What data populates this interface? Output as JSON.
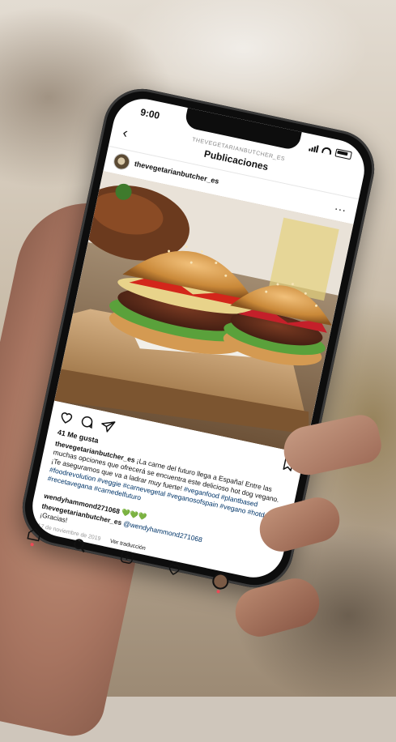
{
  "status": {
    "time": "9:00"
  },
  "header": {
    "account_handle": "THEVEGETARIANBUTCHER_ES",
    "title": "Publicaciones"
  },
  "post": {
    "username": "thevegetarianbutcher_es",
    "more_label": "...",
    "likes": "41 Me gusta",
    "caption_user": "thevegetarianbutcher_es",
    "caption_text": " ¡La carne del futuro llega a España! Entre las muchas opciones que ofrecerá se encuentra este delicioso hot dog vegano. ¡Te aseguramos que va a ladrar muy fuerte!",
    "hashtags": "#veganfood #plantbased #foodrevolution #veggie #carnevegetal #veganosofspain #vegano #hotdog #recetavegana #carnedelfuturo",
    "comment_user": "wendyhammond271068",
    "comment_text": " 💚💚💚",
    "reply_user": "thevegetarianbutcher_es",
    "reply_mention": "@wendyhammond271068",
    "reply_text": "¡Gracias!",
    "date": "17 de noviembre de 2019",
    "translate": "Ver traducción"
  },
  "icons": {
    "back": "back-arrow-icon",
    "like": "heart-icon",
    "comment": "comment-icon",
    "share": "send-icon",
    "save": "bookmark-icon",
    "nav_home": "home-icon",
    "nav_search": "search-icon",
    "nav_add": "add-post-icon",
    "nav_activity": "heart-icon",
    "nav_profile": "profile-avatar"
  },
  "colors": {
    "accent_hashtag": "#003569",
    "notification_dot": "#ed4956"
  }
}
